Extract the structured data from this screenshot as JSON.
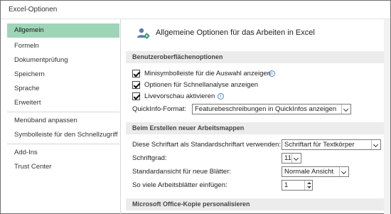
{
  "window": {
    "title": "Excel-Optionen"
  },
  "sidebar": {
    "items": [
      {
        "label": "Allgemein",
        "selected": true
      },
      {
        "label": "Formeln"
      },
      {
        "label": "Dokumentprüfung"
      },
      {
        "label": "Speichern"
      },
      {
        "label": "Sprache"
      },
      {
        "label": "Erweitert"
      },
      {
        "label": "Menüband anpassen"
      },
      {
        "label": "Symbolleiste für den Schnellzugriff"
      },
      {
        "label": "Add-Ins"
      },
      {
        "label": "Trust Center"
      }
    ]
  },
  "main": {
    "header": {
      "text": "Allgemeine Optionen für das Arbeiten in Excel",
      "icon": "settings-people-icon"
    },
    "sections": {
      "ui_options": {
        "title": "Benutzeroberflächenoptionen",
        "mini_toolbar": {
          "label": "Minisymbolleiste für die Auswahl anzeigen",
          "checked": true
        },
        "quick_analysis": {
          "label": "Optionen für Schnellanalyse anzeigen",
          "checked": true
        },
        "live_preview": {
          "label": "Livevorschau aktivieren",
          "checked": true
        },
        "quickinfo": {
          "label": "QuickInfo-Format:",
          "value": "Featurebeschreibungen in QuickInfos anzeigen"
        }
      },
      "new_workbooks": {
        "title": "Beim Erstellen neuer Arbeitsmappen",
        "default_font": {
          "label": "Diese Schriftart als Standardschriftart verwenden:",
          "value": "Schriftart für Textkörper"
        },
        "font_size": {
          "label": "Schriftgrad:",
          "value": "11"
        },
        "default_view": {
          "label": "Standardansicht für neue Blätter:",
          "value": "Normale Ansicht"
        },
        "sheet_count": {
          "label": "So viele Arbeitsblätter einfügen:",
          "value": "1"
        }
      },
      "personalize": {
        "title": "Microsoft Office-Kopie personalisieren"
      }
    }
  },
  "colors": {
    "selected_nav": "#9fd5b7",
    "section_bg": "#ececec",
    "info_icon": "#4a86c8"
  }
}
